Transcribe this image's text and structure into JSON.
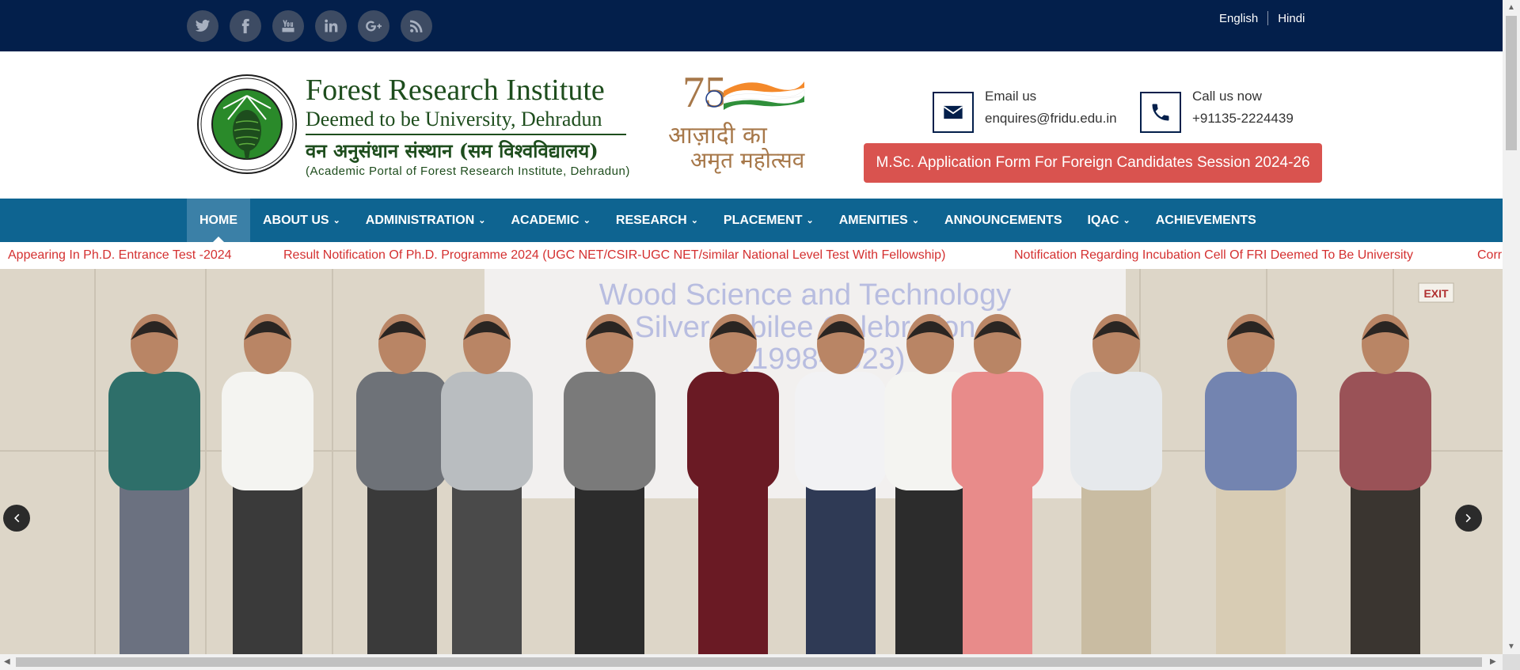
{
  "social": [
    "twitter-icon",
    "facebook-icon",
    "youtube-icon",
    "linkedin-icon",
    "google-plus-icon",
    "rss-icon"
  ],
  "languages": {
    "english": "English",
    "hindi": "Hindi"
  },
  "brand": {
    "title": "Forest Research Institute",
    "subtitle": "Deemed to be University, Dehradun",
    "hindi": "वन अनुसंधान संस्थान (सम विश्वविद्यालय)",
    "portal": "(Academic Portal of Forest Research Institute, Dehradun)"
  },
  "azadi": {
    "number": "75",
    "line1": "आज़ादी का",
    "line2": "अमृत महोत्सव"
  },
  "contact": {
    "email_label": "Email us",
    "email": "enquires@fridu.edu.in",
    "phone_label": "Call us now",
    "phone": "+91135-2224439"
  },
  "apply_button": "M.Sc. Application Form For Foreign Candidates Session 2024-26",
  "nav": [
    {
      "label": "HOME",
      "dropdown": false,
      "active": true
    },
    {
      "label": "ABOUT US",
      "dropdown": true
    },
    {
      "label": "ADMINISTRATION",
      "dropdown": true
    },
    {
      "label": "ACADEMIC",
      "dropdown": true
    },
    {
      "label": "RESEARCH",
      "dropdown": true
    },
    {
      "label": "PLACEMENT",
      "dropdown": true
    },
    {
      "label": "AMENITIES",
      "dropdown": true
    },
    {
      "label": "ANNOUNCEMENTS",
      "dropdown": false
    },
    {
      "label": "IQAC",
      "dropdown": true
    },
    {
      "label": "ACHIEVEMENTS",
      "dropdown": false
    }
  ],
  "ticker": [
    "Appearing In Ph.D. Entrance Test -2024",
    "Result Notification Of Ph.D. Programme 2024 (UGC NET/CSIR-UGC NET/similar National Level Test With Fellowship)",
    "Notification Regarding Incubation Cell Of FRI Deemed To Be University",
    "Corri"
  ],
  "slide": {
    "banner_lines": [
      "Wood Science and Technology",
      "Silver Jubilee Celebration",
      "(1998-2023)"
    ],
    "exit_sign": "EXIT"
  },
  "colors": {
    "topbar": "#031f4b",
    "nav": "#0e6491",
    "nav_active": "#3b80a7",
    "apply": "#d9534f",
    "ticker": "#d43030",
    "brand_green": "#1e4d1d"
  }
}
